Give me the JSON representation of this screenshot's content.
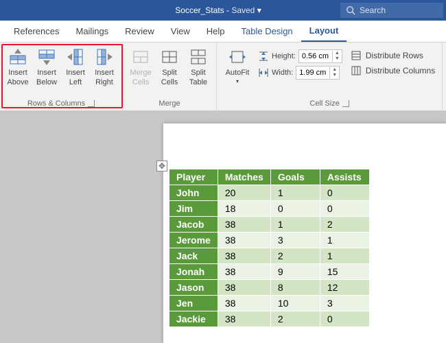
{
  "title": {
    "filename": "Soccer_Stats",
    "status": "Saved",
    "dropdown": "▾"
  },
  "search": {
    "placeholder": "Search"
  },
  "tabs": {
    "items": [
      "References",
      "Mailings",
      "Review",
      "View",
      "Help",
      "Table Design",
      "Layout"
    ],
    "active": "Layout"
  },
  "ribbon": {
    "rows_cols": {
      "label": "Rows & Columns",
      "buttons": [
        {
          "l1": "Insert",
          "l2": "Above"
        },
        {
          "l1": "Insert",
          "l2": "Below"
        },
        {
          "l1": "Insert",
          "l2": "Left"
        },
        {
          "l1": "Insert",
          "l2": "Right"
        }
      ]
    },
    "merge": {
      "label": "Merge",
      "buttons": [
        {
          "l1": "Merge",
          "l2": "Cells"
        },
        {
          "l1": "Split",
          "l2": "Cells"
        },
        {
          "l1": "Split",
          "l2": "Table"
        }
      ]
    },
    "autofit": {
      "l1": "AutoFit",
      "drop": "▾"
    },
    "cellsize": {
      "label": "Cell Size",
      "height_label": "Height:",
      "width_label": "Width:",
      "height_value": "0.56 cm",
      "width_value": "1.99 cm",
      "dist_rows": "Distribute Rows",
      "dist_cols": "Distribute Columns"
    }
  },
  "table": {
    "headers": [
      "Player",
      "Matches",
      "Goals",
      "Assists"
    ],
    "rows": [
      {
        "name": "John",
        "v": [
          "20",
          "1",
          "0"
        ]
      },
      {
        "name": "Jim",
        "v": [
          "18",
          "0",
          "0"
        ]
      },
      {
        "name": "Jacob",
        "v": [
          "38",
          "1",
          "2"
        ]
      },
      {
        "name": "Jerome",
        "v": [
          "38",
          "3",
          "1"
        ]
      },
      {
        "name": "Jack",
        "v": [
          "38",
          "2",
          "1"
        ]
      },
      {
        "name": "Jonah",
        "v": [
          "38",
          "9",
          "15"
        ]
      },
      {
        "name": "Jason",
        "v": [
          "38",
          "8",
          "12"
        ]
      },
      {
        "name": "Jen",
        "v": [
          "38",
          "10",
          "3"
        ]
      },
      {
        "name": "Jackie",
        "v": [
          "38",
          "2",
          "0"
        ]
      }
    ]
  }
}
